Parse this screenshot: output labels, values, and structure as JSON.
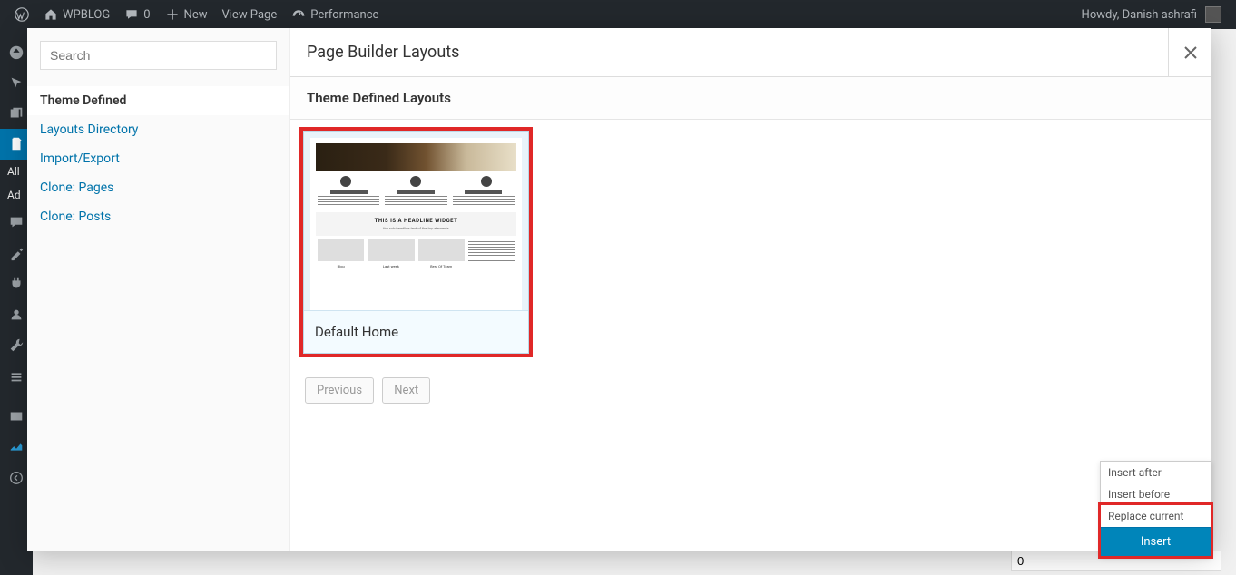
{
  "adminbar": {
    "site": "WPBLOG",
    "comments": "0",
    "new": "New",
    "view": "View Page",
    "performance": "Performance",
    "greeting": "Howdy, Danish ashrafi"
  },
  "rail": {
    "all": "All",
    "add": "Ad"
  },
  "modal": {
    "title": "Page Builder Layouts",
    "section": "Theme Defined Layouts",
    "search_placeholder": "Search"
  },
  "sidebar": {
    "items": [
      {
        "label": "Theme Defined",
        "active": true
      },
      {
        "label": "Layouts Directory",
        "active": false
      },
      {
        "label": "Import/Export",
        "active": false
      },
      {
        "label": "Clone: Pages",
        "active": false
      },
      {
        "label": "Clone: Posts",
        "active": false
      }
    ]
  },
  "layouts": [
    {
      "title": "Default Home",
      "headline": "THIS IS A HEADLINE WIDGET",
      "sub": "the sub-headline text of the top elements"
    }
  ],
  "pagination": {
    "prev": "Previous",
    "next": "Next"
  },
  "insert": {
    "options": [
      "Insert after",
      "Insert before",
      "Replace current"
    ],
    "action": "Insert"
  },
  "page_meta": {
    "count": "0"
  }
}
